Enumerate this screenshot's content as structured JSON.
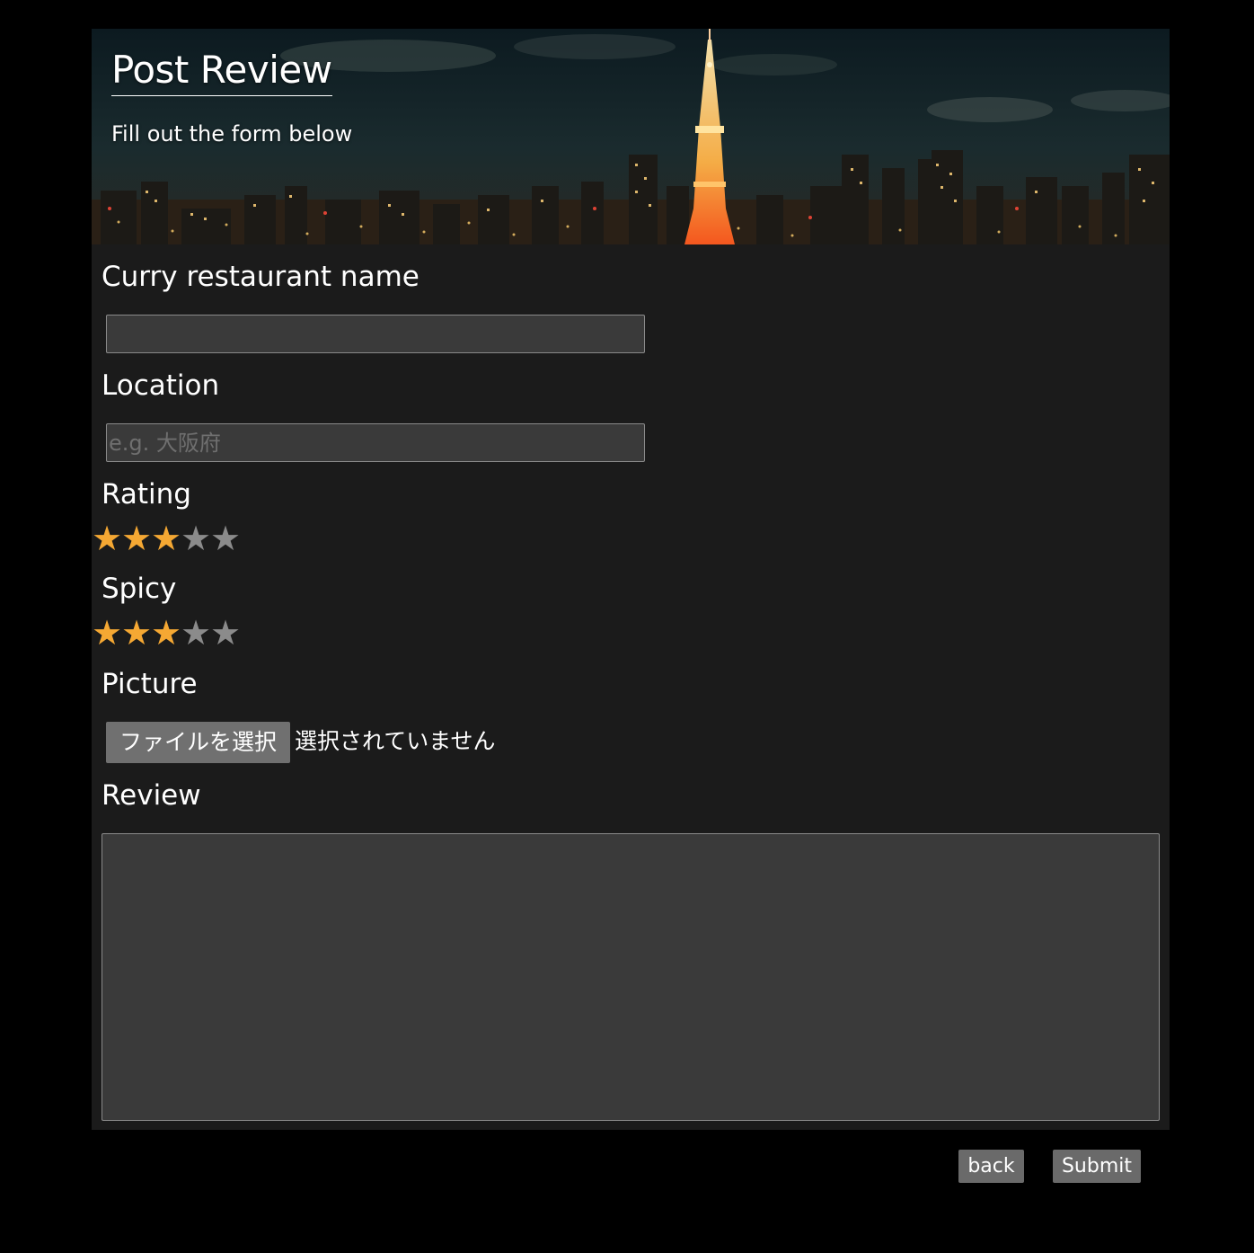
{
  "header": {
    "title": "Post Review",
    "subtitle": "Fill out the form below"
  },
  "form": {
    "restaurant_name": {
      "label": "Curry restaurant name",
      "value": "",
      "placeholder": ""
    },
    "location": {
      "label": "Location",
      "value": "",
      "placeholder": "e.g. 大阪府"
    },
    "rating": {
      "label": "Rating",
      "value": 3,
      "max": 5
    },
    "spicy": {
      "label": "Spicy",
      "value": 3,
      "max": 5
    },
    "picture": {
      "label": "Picture",
      "button_label": "ファイルを選択",
      "status": "選択されていません"
    },
    "review": {
      "label": "Review",
      "value": ""
    }
  },
  "actions": {
    "back_label": "back",
    "submit_label": "Submit"
  },
  "colors": {
    "star_active": "#f5a833",
    "star_inactive": "#8b8b8b",
    "panel_bg": "#1b1b1b",
    "input_bg": "#3a3a3a",
    "button_bg": "#6a6a6a"
  },
  "icons": {
    "star": "★"
  }
}
